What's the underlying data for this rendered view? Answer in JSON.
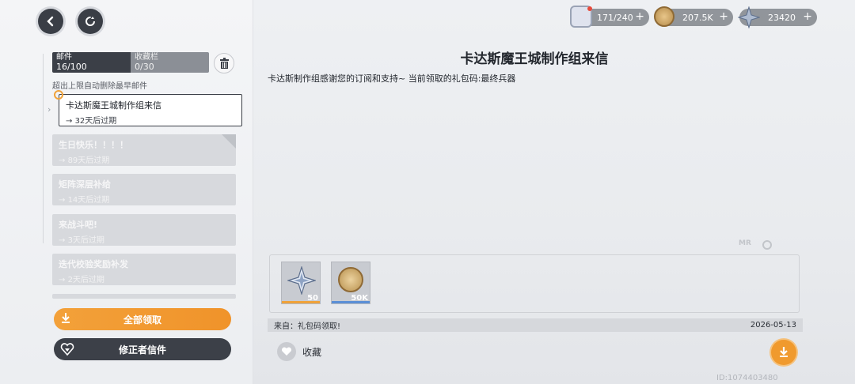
{
  "nav": {
    "back_icon": "back-arrow-icon",
    "refresh_icon": "refresh-icon"
  },
  "tabs": {
    "mail": {
      "label": "邮件",
      "count": "16/100"
    },
    "favorites": {
      "label": "收藏栏",
      "count": "0/30"
    }
  },
  "hint": "超出上限自动删除最早邮件",
  "mail_list": [
    {
      "title": "卡达斯魔王城制作组来信",
      "expire": "32天后过期",
      "selected": true
    },
    {
      "title": "生日快乐！！！！",
      "expire": "89天后过期",
      "selected": false
    },
    {
      "title": "矩阵深层补给",
      "expire": "14天后过期",
      "selected": false
    },
    {
      "title": "来战斗吧!",
      "expire": "3天后过期",
      "selected": false
    },
    {
      "title": "迭代校验奖励补发",
      "expire": "2天后过期",
      "selected": false
    }
  ],
  "buttons": {
    "claim_all": "全部领取",
    "corrector_letter": "修正者信件",
    "favorite": "收藏"
  },
  "currencies": [
    {
      "name": "stamina",
      "value": "171/240"
    },
    {
      "name": "gold",
      "value": "207.5K"
    },
    {
      "name": "crystal",
      "value": "23420"
    }
  ],
  "mail": {
    "title": "卡达斯魔王城制作组来信",
    "body": "卡达斯制作组感谢您的订阅和支持~  当前领取的礼包码:最终兵器",
    "from": "来自：礼包码领取!",
    "date": "2026-05-13",
    "attachments": [
      {
        "name": "crystal",
        "qty": "50"
      },
      {
        "name": "gold",
        "qty": "50K"
      }
    ]
  },
  "user_id": "ID:1074403480",
  "colors": {
    "accent": "#f09a2e",
    "dark": "#3a3e46"
  }
}
